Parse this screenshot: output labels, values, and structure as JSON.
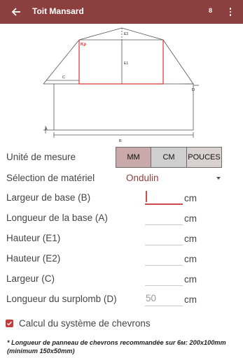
{
  "app": {
    "title": "Toit Mansard",
    "badge": "8",
    "back_icon": "arrow-left-icon",
    "menu_icon": "more-vertical-icon",
    "primary_color": "#8c3f3f"
  },
  "diagram": {
    "labels": {
      "e2": "E2",
      "kp": "Kp",
      "e1": "E1",
      "c": "C",
      "d": "D",
      "a": "A",
      "b": "B"
    }
  },
  "form": {
    "unit_label": "Unité de mesure",
    "units": [
      "MM",
      "CM",
      "POUCES"
    ],
    "selected_unit": "MM",
    "material_label": "Sélection de matériel",
    "material_value": "Ondulin",
    "fields": [
      {
        "label": "Largeur de base (B)",
        "value": "",
        "unit": "cm"
      },
      {
        "label": "Longueur de la base (A)",
        "value": "",
        "unit": "cm"
      },
      {
        "label": "Hauteur (E1)",
        "value": "",
        "unit": "cm"
      },
      {
        "label": "Hauteur (E2)",
        "value": "",
        "unit": "cm"
      },
      {
        "label": "Largeur (C)",
        "value": "",
        "unit": "cm"
      },
      {
        "label": "Longueur du surplomb (D)",
        "value": "50",
        "unit": "cm"
      }
    ],
    "checkbox_label": "Calcul du système de chevrons",
    "checkbox_checked": true,
    "note": "* Longueur de panneau de chevrons recommandée sur 6м: 200x100mm (minimum 150x50mm)"
  }
}
